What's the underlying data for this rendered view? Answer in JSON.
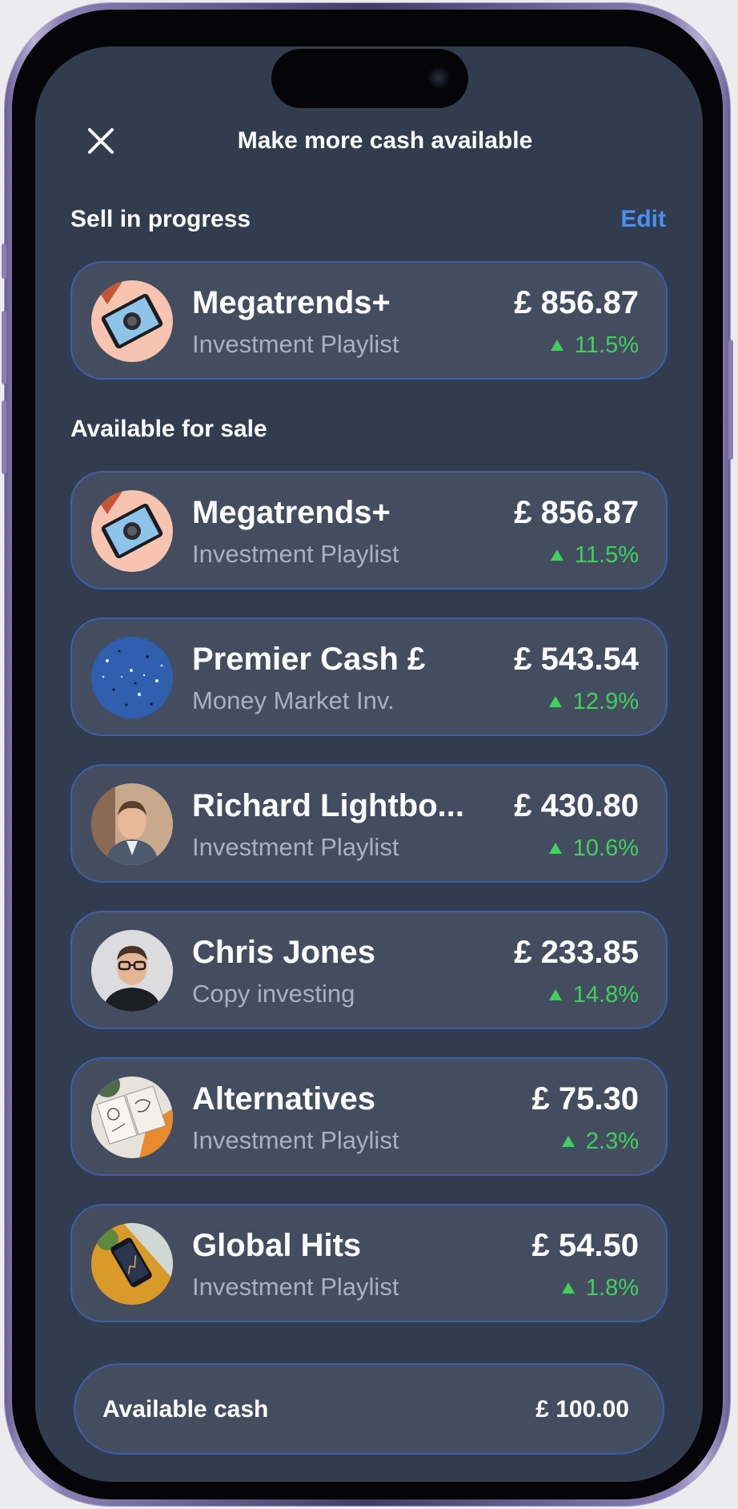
{
  "header": {
    "title": "Make more cash available",
    "close_icon": "close-icon"
  },
  "sell_in_progress": {
    "label": "Sell in progress",
    "edit_label": "Edit",
    "items": [
      {
        "name": "Megatrends+",
        "subtitle": "Investment Playlist",
        "value": "£ 856.87",
        "change": "11.5%",
        "thumb": "tablet-vr-headset-thumb"
      }
    ]
  },
  "available_for_sale": {
    "label": "Available for sale",
    "items": [
      {
        "name": "Megatrends+",
        "subtitle": "Investment Playlist",
        "value": "£ 856.87",
        "change": "11.5%",
        "thumb": "tablet-vr-headset-thumb"
      },
      {
        "name": "Premier Cash £",
        "subtitle": "Money Market Inv.",
        "value": "£ 543.54",
        "change": "12.9%",
        "thumb": "blue-glitter-thumb"
      },
      {
        "name": "Richard Lightbo...",
        "subtitle": "Investment Playlist",
        "value": "£ 430.80",
        "change": "10.6%",
        "thumb": "man-in-suit-portrait"
      },
      {
        "name": "Chris Jones",
        "subtitle": "Copy investing",
        "value": "£ 233.85",
        "change": "14.8%",
        "thumb": "man-with-glasses-portrait"
      },
      {
        "name": "Alternatives",
        "subtitle": "Investment Playlist",
        "value": "£ 75.30",
        "change": "2.3%",
        "thumb": "sketchbook-drawings-thumb"
      },
      {
        "name": "Global Hits",
        "subtitle": "Investment Playlist",
        "value": "£ 54.50",
        "change": "1.8%",
        "thumb": "phone-on-map-thumb"
      }
    ]
  },
  "footer": {
    "cash_label": "Available cash",
    "cash_value": "£ 100.00"
  },
  "colors": {
    "background": "#323c4f",
    "card": "#444d60",
    "card_border": "#3d5fa8",
    "accent": "#4a90f0",
    "positive": "#3fd15a",
    "subtext": "#a9b0be"
  }
}
